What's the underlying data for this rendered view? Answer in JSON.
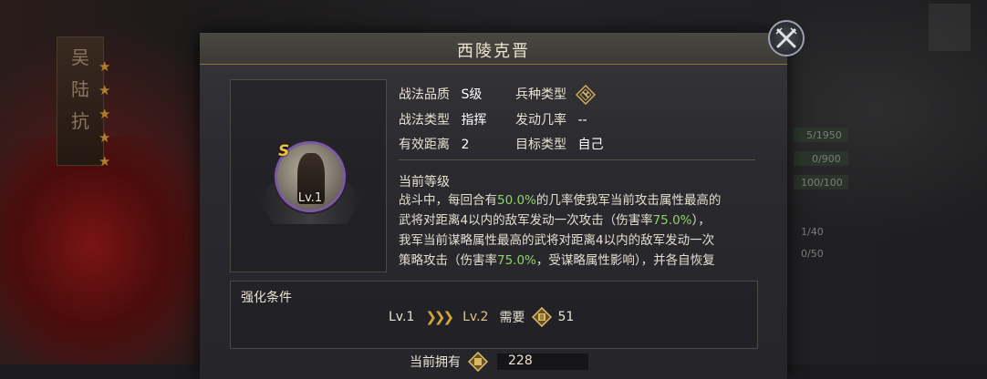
{
  "dialog": {
    "title": "西陵克晋"
  },
  "tactic": {
    "grade_letter": "S",
    "level": "Lv.1",
    "quality_label": "战法品质",
    "quality_value": "S级",
    "troop_label": "兵种类型",
    "type_label": "战法类型",
    "type_value": "指挥",
    "trigger_label": "发动几率",
    "trigger_value": "--",
    "range_label": "有效距离",
    "range_value": "2",
    "target_label": "目标类型",
    "target_value": "自己"
  },
  "description": {
    "section_title": "当前等级",
    "line1_a": "战斗中，每回合有",
    "line1_hl": "50.0%",
    "line1_b": "的几率使我军当前攻击属性最高的",
    "line2_a": "武将对距离4以内的敌军发动一次攻击（伤害率",
    "line2_hl": "75.0%",
    "line2_b": "），",
    "line3": "我军当前谋略属性最高的武将对距离4以内的敌军发动一次",
    "line4_a": "策略攻击（伤害率",
    "line4_hl": "75.0%",
    "line4_b": "，受谋略属性影响），并各自恢复"
  },
  "enhance": {
    "title": "强化条件",
    "from_level": "Lv.1",
    "to_level": "Lv.2",
    "need_label": "需要",
    "need_value": "51"
  },
  "owned": {
    "label": "当前拥有",
    "value": "228"
  },
  "background": {
    "banner_chars": "吴\n陆\n抗",
    "stat1": "5/1950",
    "stat2": "0/900",
    "stat3": "100/100",
    "stat4": "1/40",
    "stat5": "0/50"
  },
  "colors": {
    "highlight": "#8fd36a",
    "gold": "#d4a53a",
    "portrait_ring": "#7a5aa0"
  },
  "icons": {
    "close": "close-x-icon",
    "troop": "troop-type-icon",
    "token": "tactic-point-icon"
  }
}
